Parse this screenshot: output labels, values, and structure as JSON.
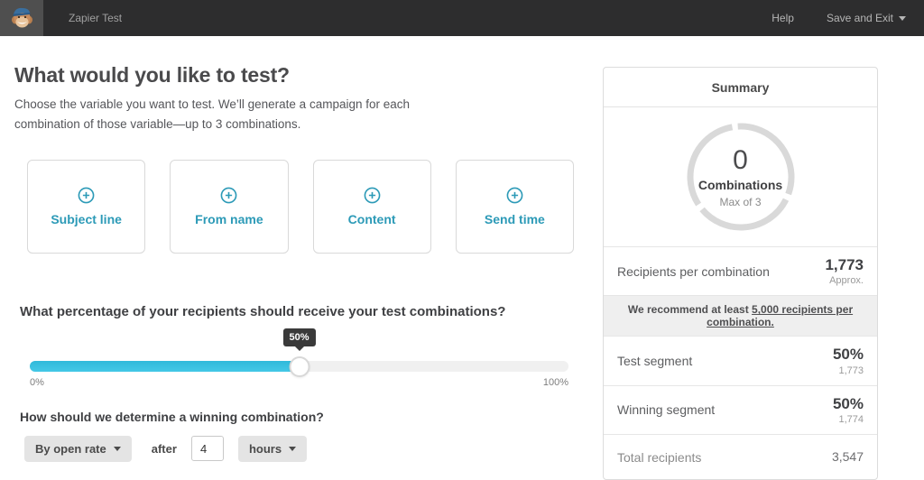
{
  "topbar": {
    "title": "Zapier Test",
    "help_label": "Help",
    "save_exit_label": "Save and Exit"
  },
  "main": {
    "heading": "What would you like to test?",
    "description": "Choose the variable you want to test. We’ll generate a campaign for each combination of those variable—up to 3 combinations.",
    "variables": [
      {
        "label": "Subject line"
      },
      {
        "label": "From name"
      },
      {
        "label": "Content"
      },
      {
        "label": "Send time"
      }
    ],
    "slider": {
      "question": "What percentage of your recipients should receive your test combinations?",
      "value_label": "50%",
      "value_percent": 50,
      "min_label": "0%",
      "max_label": "100%"
    },
    "winner": {
      "question": "How should we determine a winning combination?",
      "metric_selected": "By open rate",
      "after_label": "after",
      "duration_value": "4",
      "unit_selected": "hours"
    }
  },
  "summary": {
    "title": "Summary",
    "combinations": {
      "count": "0",
      "label": "Combinations",
      "max_label": "Max of 3"
    },
    "recipients_per_combination": {
      "label": "Recipients per combination",
      "value": "1,773",
      "sub": "Approx."
    },
    "recommendation": {
      "prefix": "We recommend at least ",
      "underlined": "5,000 recipients per combination."
    },
    "test_segment": {
      "label": "Test segment",
      "value": "50%",
      "sub": "1,773"
    },
    "winning_segment": {
      "label": "Winning segment",
      "value": "50%",
      "sub": "1,774"
    },
    "total_recipients": {
      "label": "Total recipients",
      "value": "3,547"
    }
  },
  "colors": {
    "accent_teal": "#2c9ab7",
    "slider_fill": "#36c0e0",
    "topbar_bg": "#2d2d2e",
    "ring_gray": "#d9d9d9"
  }
}
